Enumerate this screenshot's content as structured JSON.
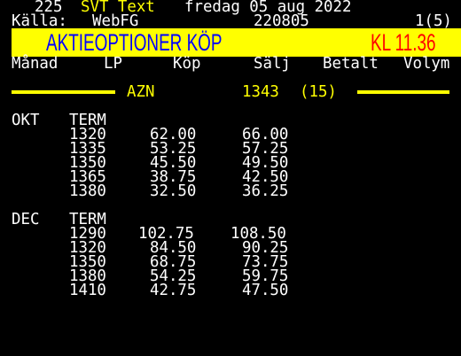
{
  "header": {
    "page_number": "225",
    "service": "SVT Text",
    "date_text": "fredag 05 aug 2022",
    "source_label": "Källa:",
    "source_value": "WebFG",
    "data_date": "220805",
    "page_index": "1(5)"
  },
  "title": {
    "left": "AKTIEOPTIONER KÖP",
    "right": "KL 11.36"
  },
  "columns": [
    "Månad",
    "LP",
    "Köp",
    "Sälj",
    "Betalt",
    "Volym"
  ],
  "instrument": {
    "ticker": "AZN",
    "price": "1343",
    "count": "(15)"
  },
  "groups": [
    {
      "month": "OKT",
      "sub": "TERM",
      "rows": [
        {
          "lp": "1320",
          "kop": "62.00",
          "salj": "66.00"
        },
        {
          "lp": "1335",
          "kop": "53.25",
          "salj": "57.25"
        },
        {
          "lp": "1350",
          "kop": "45.50",
          "salj": "49.50"
        },
        {
          "lp": "1365",
          "kop": "38.75",
          "salj": "42.50"
        },
        {
          "lp": "1380",
          "kop": "32.50",
          "salj": "36.25"
        }
      ]
    },
    {
      "month": "DEC",
      "sub": "TERM",
      "rows": [
        {
          "lp": "1290",
          "kop": "102.75",
          "salj": "108.50"
        },
        {
          "lp": "1320",
          "kop": "84.50",
          "salj": "90.25"
        },
        {
          "lp": "1350",
          "kop": "68.75",
          "salj": "73.75"
        },
        {
          "lp": "1380",
          "kop": "54.25",
          "salj": "59.75"
        },
        {
          "lp": "1410",
          "kop": "42.75",
          "salj": "47.50"
        }
      ]
    }
  ],
  "colors": {
    "background": "#000000",
    "text": "#ffffff",
    "accent": "#ffff00",
    "title_left": "#0000ff",
    "title_right": "#ff0000"
  }
}
